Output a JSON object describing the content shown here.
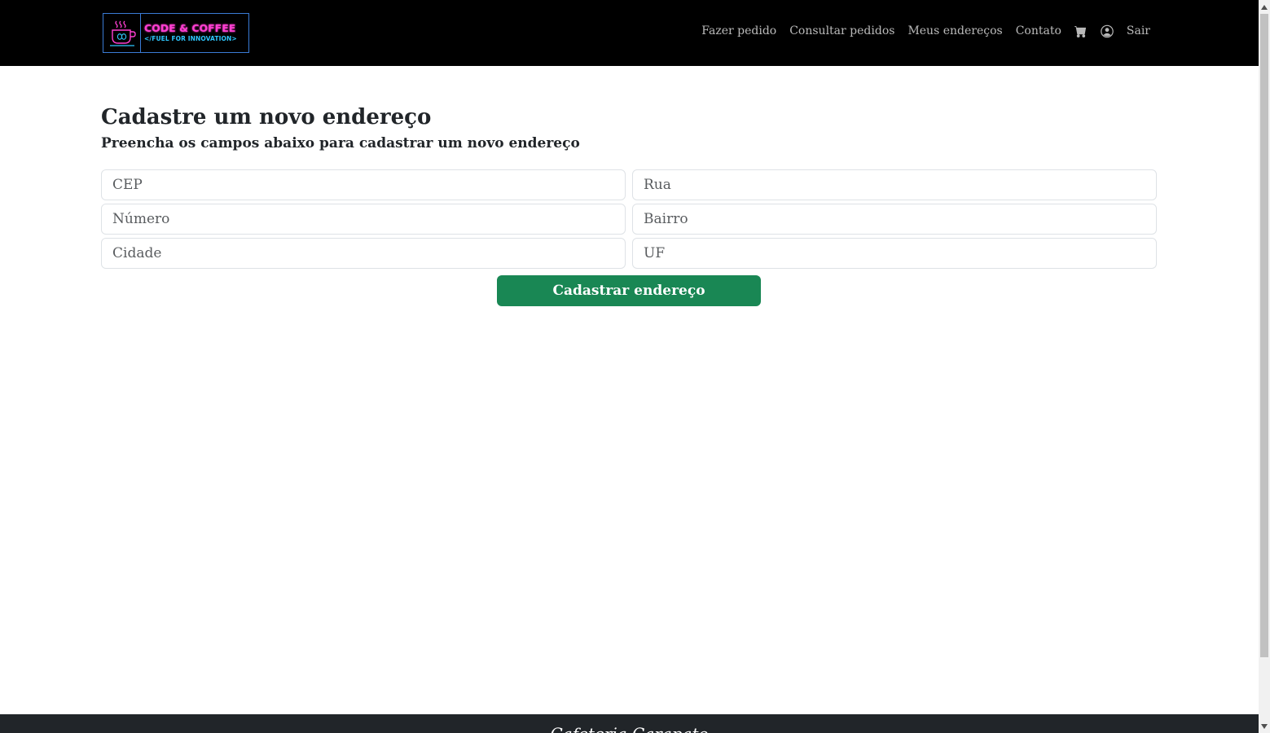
{
  "brand": {
    "name": "CODE & COFFEE",
    "tagline": "</FUEL FOR INNOVATION>",
    "colors": {
      "pink": "#ff3fd2",
      "cyan": "#2ec8ff",
      "border": "#3a7bd5"
    }
  },
  "nav": {
    "items": [
      {
        "label": "Fazer pedido"
      },
      {
        "label": "Consultar pedidos"
      },
      {
        "label": "Meus endereços"
      },
      {
        "label": "Contato"
      }
    ],
    "cart_icon": "cart-icon",
    "user_icon": "user-circle-icon",
    "logout_label": "Sair"
  },
  "main": {
    "title": "Cadastre um novo endereço",
    "subtitle": "Preencha os campos abaixo para cadastrar um novo endereço",
    "fields": {
      "cep": {
        "placeholder": "CEP",
        "value": ""
      },
      "rua": {
        "placeholder": "Rua",
        "value": ""
      },
      "numero": {
        "placeholder": "Número",
        "value": ""
      },
      "bairro": {
        "placeholder": "Bairro",
        "value": ""
      },
      "cidade": {
        "placeholder": "Cidade",
        "value": ""
      },
      "uf": {
        "placeholder": "UF",
        "value": ""
      }
    },
    "submit_label": "Cadastrar endereço",
    "submit_color": "#198754"
  },
  "footer": {
    "text": "Cafeteria Carapato"
  }
}
